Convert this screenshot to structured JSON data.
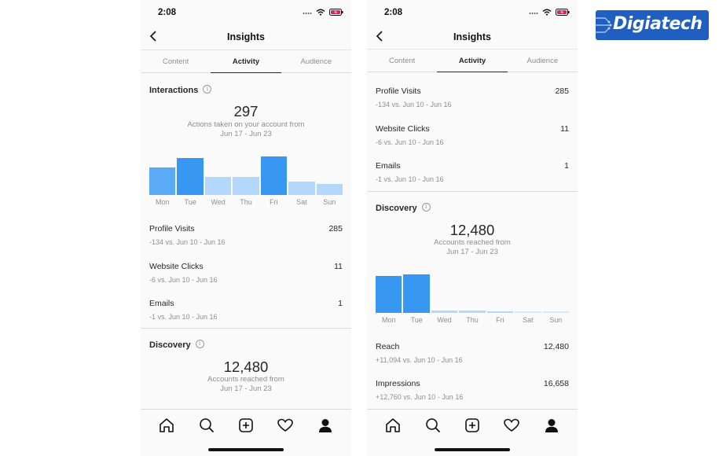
{
  "colors": {
    "bar_dark": "#3897f0",
    "bar_mid": "#5aaaf5",
    "bar_light": "#b3d8fb",
    "bar_faint": "#d7eafc",
    "logo_bg": "#1e5fc1"
  },
  "logo": {
    "text": "Digiatech"
  },
  "left": {
    "status": {
      "time": "2:08"
    },
    "header": {
      "title": "Insights"
    },
    "tabs": [
      {
        "label": "Content"
      },
      {
        "label": "Activity"
      },
      {
        "label": "Audience"
      }
    ],
    "interactions": {
      "title": "Interactions",
      "value": "297",
      "desc": "Actions taken on your account from",
      "range": "Jun 17 - Jun 23",
      "days": [
        "Mon",
        "Tue",
        "Wed",
        "Thu",
        "Fri",
        "Sat",
        "Sun"
      ],
      "bar_levels": [
        0.58,
        0.78,
        0.38,
        0.38,
        0.81,
        0.29,
        0.24
      ],
      "bar_tones": [
        "mid",
        "dark",
        "light",
        "light",
        "dark",
        "light",
        "light"
      ]
    },
    "metrics": [
      {
        "label": "Profile Visits",
        "value": "285",
        "sub": "-134 vs. Jun 10 - Jun 16"
      },
      {
        "label": "Website Clicks",
        "value": "11",
        "sub": "-6 vs. Jun 10 - Jun 16"
      },
      {
        "label": "Emails",
        "value": "1",
        "sub": "-1 vs. Jun 10 - Jun 16"
      }
    ],
    "discovery": {
      "title": "Discovery",
      "value": "12,480",
      "desc": "Accounts reached from",
      "range": "Jun 17 - Jun 23"
    },
    "nav_icons": [
      "home-icon",
      "search-icon",
      "add-post-icon",
      "heart-icon",
      "profile-icon"
    ]
  },
  "right": {
    "status": {
      "time": "2:08"
    },
    "header": {
      "title": "Insights"
    },
    "tabs": [
      {
        "label": "Content"
      },
      {
        "label": "Activity"
      },
      {
        "label": "Audience"
      }
    ],
    "metrics": [
      {
        "label": "Profile Visits",
        "value": "285",
        "sub": "-134 vs. Jun 10 - Jun 16"
      },
      {
        "label": "Website Clicks",
        "value": "11",
        "sub": "-6 vs. Jun 10 - Jun 16"
      },
      {
        "label": "Emails",
        "value": "1",
        "sub": "-1 vs. Jun 10 - Jun 16"
      }
    ],
    "discovery": {
      "title": "Discovery",
      "value": "12,480",
      "desc": "Accounts reached from",
      "range": "Jun 17 - Jun 23",
      "days": [
        "Mon",
        "Tue",
        "Wed",
        "Thu",
        "Fri",
        "Sat",
        "Sun"
      ],
      "bar_levels": [
        0.78,
        0.82,
        0.05,
        0.05,
        0.04,
        0.02,
        0.02
      ],
      "bar_tones": [
        "dark",
        "dark",
        "light",
        "light",
        "light",
        "faint",
        "faint"
      ]
    },
    "reach": [
      {
        "label": "Reach",
        "value": "12,480",
        "sub": "+11,094 vs. Jun 10 - Jun 16"
      },
      {
        "label": "Impressions",
        "value": "16,658",
        "sub": "+12,760 vs. Jun 10 - Jun 16"
      }
    ],
    "nav_icons": [
      "home-icon",
      "search-icon",
      "add-post-icon",
      "heart-icon",
      "profile-icon"
    ]
  }
}
